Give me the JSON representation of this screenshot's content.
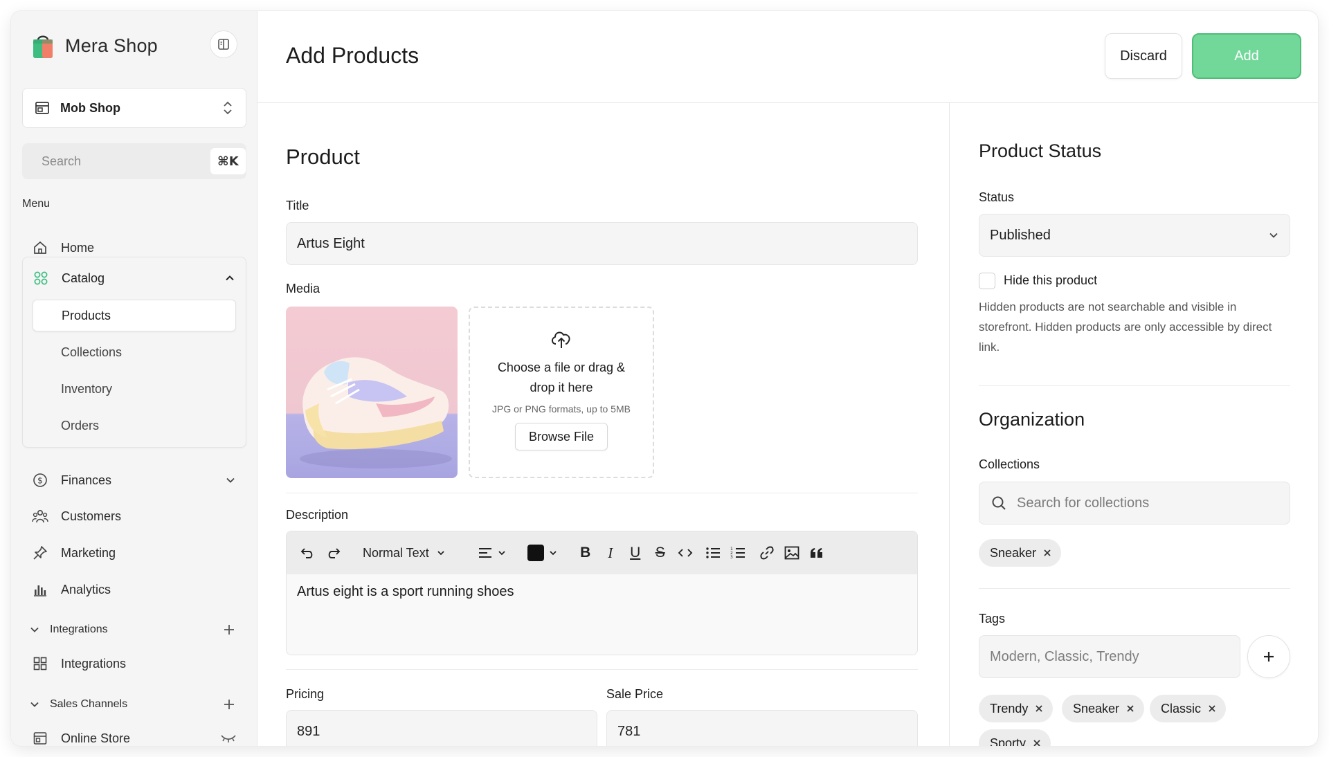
{
  "brand": {
    "name": "Mera Shop",
    "logo_icon": "shopping-bag-icon"
  },
  "store": {
    "name": "Mob Shop"
  },
  "search": {
    "placeholder": "Search",
    "shortcut": "⌘K"
  },
  "menu": {
    "label": "Menu",
    "home": "Home",
    "catalog": {
      "label": "Catalog",
      "items": [
        "Products",
        "Collections",
        "Inventory",
        "Orders"
      ]
    },
    "finances": "Finances",
    "customers": "Customers",
    "marketing": "Marketing",
    "analytics": "Analytics",
    "integrations_section": "Integrations",
    "integrations_item": "Integrations",
    "sales_channels_section": "Sales Channels",
    "online_store": "Online Store"
  },
  "header": {
    "title": "Add Products",
    "discard": "Discard",
    "add": "Add"
  },
  "product": {
    "heading": "Product",
    "title_label": "Title",
    "title_value": "Artus Eight",
    "media_label": "Media",
    "dropzone": {
      "title": "Choose a file or drag & drop it here",
      "note": "JPG or PNG formats, up to 5MB",
      "browse": "Browse File"
    },
    "description_label": "Description",
    "description_text": "Artus eight is a sport running shoes",
    "text_style": "Normal Text",
    "pricing_label": "Pricing",
    "pricing_value": "891",
    "sale_price_label": "Sale Price",
    "sale_price_value": "781"
  },
  "status": {
    "heading": "Product Status",
    "label": "Status",
    "value": "Published",
    "hide_label": "Hide this product",
    "help": "Hidden products are not searchable and visible in storefront. Hidden products are only accessible by direct link."
  },
  "organization": {
    "heading": "Organization",
    "collections_label": "Collections",
    "collections_placeholder": "Search for collections",
    "collection_chips": [
      "Sneaker"
    ],
    "tags_label": "Tags",
    "tags_placeholder": "Modern, Classic, Trendy",
    "tag_chips": [
      "Trendy",
      "Sneaker",
      "Classic",
      "Sporty"
    ]
  },
  "colors": {
    "accent": "#72d89a",
    "accent_border": "#4fbd78",
    "sidebar_bg": "#f5f5f5",
    "text_color_swatch": "#111111"
  }
}
